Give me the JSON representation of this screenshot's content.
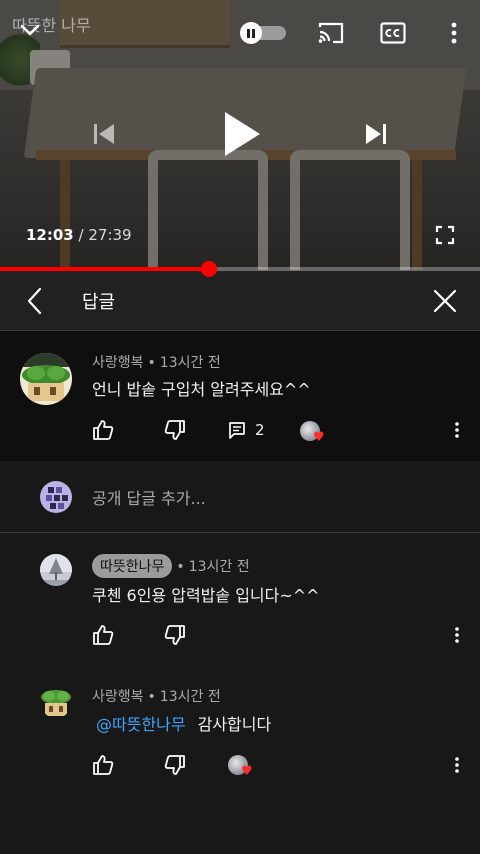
{
  "player": {
    "channel_title": "따뜻한 나무",
    "current_time": "12:03",
    "duration": "/ 27:39",
    "progress_fraction": 0.436,
    "accent": "#ff0000"
  },
  "panel": {
    "title": "답글"
  },
  "parent_comment": {
    "author": "사랑행복",
    "time": "13시간 전",
    "text": "언니 밥솥 구입처 알려주세요^^",
    "reply_count": "2"
  },
  "add_reply": {
    "placeholder": "공개 답글 추가..."
  },
  "replies": [
    {
      "author": "따뜻한나무",
      "time": "13시간 전",
      "text": "쿠첸 6인용 압력밥솥 입니다~^^"
    },
    {
      "author": "사랑행복",
      "time": "13시간 전",
      "mention": "@따뜻한나무",
      "text": "감사합니다"
    }
  ],
  "icons": {
    "like": "thumbs-up-icon",
    "dislike": "thumbs-down-icon",
    "reply": "comment-icon",
    "creator_heart": "heart-icon",
    "more": "more-vertical-icon"
  }
}
